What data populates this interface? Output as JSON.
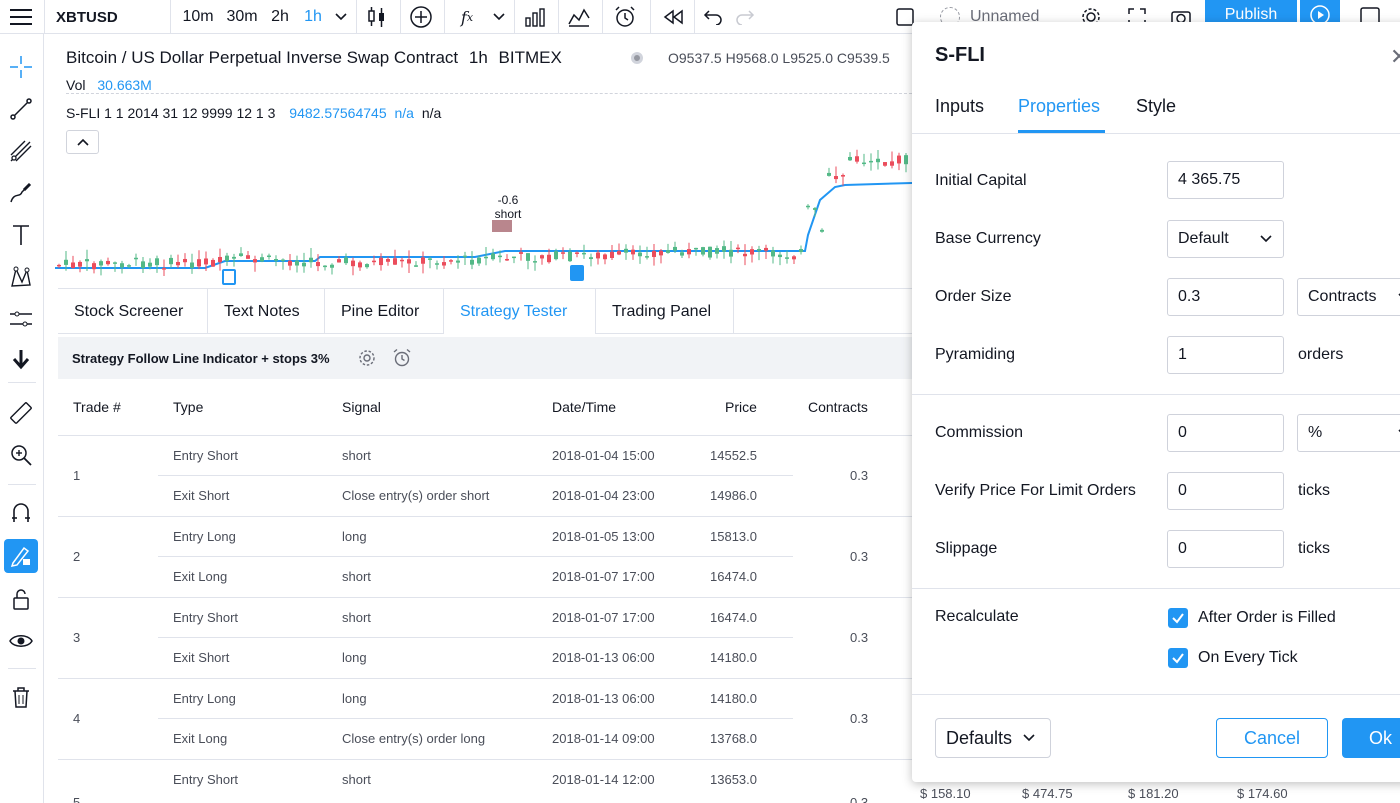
{
  "toolbar": {
    "symbol": "XBTUSD",
    "intervals": [
      "10m",
      "30m",
      "2h",
      "1h"
    ],
    "layout_name": "Unnamed",
    "publish_label": "Publish"
  },
  "chart": {
    "title": "Bitcoin / US Dollar Perpetual Inverse Swap Contract",
    "interval": "1h",
    "exchange": "BITMEX",
    "ohlc": "O9537.5  H9568.0  L9525.0  C9539.5",
    "vol_label": "Vol",
    "vol_value": "30.663M",
    "study_label": "S-FLI 1 1 2014 31 12 9999 12 1 3",
    "study_value": "9482.57564745",
    "study_na1": "n/a",
    "study_na2": "n/a",
    "marker_value": "-0.6",
    "marker_label": "short"
  },
  "bottom_tabs": [
    "Stock Screener",
    "Text Notes",
    "Pine Editor",
    "Strategy Tester",
    "Trading Panel"
  ],
  "strategy": {
    "title": "Strategy Follow Line Indicator + stops 3%"
  },
  "trades": {
    "headers": {
      "trade": "Trade #",
      "type": "Type",
      "signal": "Signal",
      "datetime": "Date/Time",
      "price": "Price",
      "contracts": "Contracts"
    },
    "rows": [
      {
        "num": "1",
        "contracts": "0.3",
        "entry": {
          "type": "Entry Short",
          "signal": "short",
          "datetime": "2018-01-04 15:00",
          "price": "14552.5"
        },
        "exit": {
          "type": "Exit Short",
          "signal": "Close entry(s) order short",
          "datetime": "2018-01-04 23:00",
          "price": "14986.0"
        }
      },
      {
        "num": "2",
        "contracts": "0.3",
        "entry": {
          "type": "Entry Long",
          "signal": "long",
          "datetime": "2018-01-05 13:00",
          "price": "15813.0"
        },
        "exit": {
          "type": "Exit Long",
          "signal": "short",
          "datetime": "2018-01-07 17:00",
          "price": "16474.0"
        }
      },
      {
        "num": "3",
        "contracts": "0.3",
        "entry": {
          "type": "Entry Short",
          "signal": "short",
          "datetime": "2018-01-07 17:00",
          "price": "16474.0"
        },
        "exit": {
          "type": "Exit Short",
          "signal": "long",
          "datetime": "2018-01-13 06:00",
          "price": "14180.0"
        }
      },
      {
        "num": "4",
        "contracts": "0.3",
        "entry": {
          "type": "Entry Long",
          "signal": "long",
          "datetime": "2018-01-13 06:00",
          "price": "14180.0"
        },
        "exit": {
          "type": "Exit Long",
          "signal": "Close entry(s) order long",
          "datetime": "2018-01-14 09:00",
          "price": "13768.0"
        }
      },
      {
        "num": "5",
        "contracts": "0.3",
        "entry": {
          "type": "Entry Short",
          "signal": "short",
          "datetime": "2018-01-14 12:00",
          "price": "13653.0"
        }
      }
    ]
  },
  "dialog": {
    "title": "S-FLI",
    "tabs": [
      "Inputs",
      "Properties",
      "Style"
    ],
    "initial_capital_label": "Initial Capital",
    "initial_capital_value": "4 365.75",
    "base_currency_label": "Base Currency",
    "base_currency_value": "Default",
    "order_size_label": "Order Size",
    "order_size_value": "0.3",
    "order_size_unit": "Contracts",
    "pyramiding_label": "Pyramiding",
    "pyramiding_value": "1",
    "pyramiding_suffix": "orders",
    "commission_label": "Commission",
    "commission_value": "0",
    "commission_unit": "%",
    "verify_label": "Verify Price For Limit Orders",
    "verify_value": "0",
    "verify_suffix": "ticks",
    "slippage_label": "Slippage",
    "slippage_value": "0",
    "slippage_suffix": "ticks",
    "recalc_label": "Recalculate",
    "recalc_after_fill": "After Order is Filled",
    "recalc_every_tick": "On Every Tick",
    "defaults_label": "Defaults",
    "cancel_label": "Cancel",
    "ok_label": "Ok"
  },
  "price_strip": [
    "$ 158.10",
    "$ 474.75",
    "$ 181.20",
    "$ 174.60"
  ],
  "colors": {
    "accent": "#2196f3",
    "candle_up": "#53b987",
    "candle_down": "#eb4d5c"
  }
}
